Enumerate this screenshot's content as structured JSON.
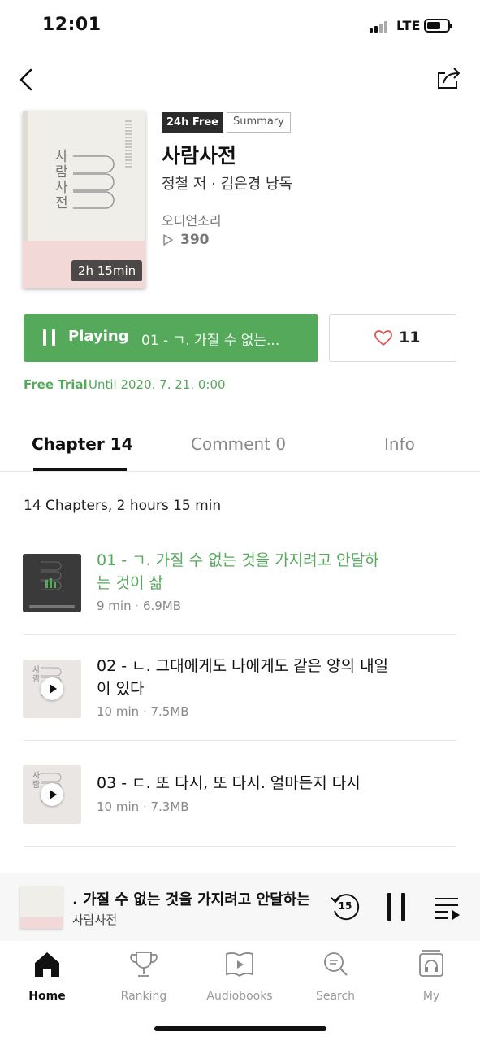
{
  "status_bar": {
    "time": "12:01",
    "network": "LTE"
  },
  "book": {
    "badge_free": "24h Free",
    "badge_summary": "Summary",
    "title": "사람사전",
    "authors": "정철 저 · 김은경 낭독",
    "publisher": "오디언소리",
    "play_count": "390",
    "duration": "2h 15min",
    "cover_title": "사람사전"
  },
  "actions": {
    "playing_label": "Playing",
    "playing_track": "01 - ㄱ. 가질 수 없는...",
    "like_count": "11"
  },
  "free_trial": {
    "label": "Free Trial",
    "until": "Until 2020. 7. 21. 0:00"
  },
  "tabs": [
    {
      "label": "Chapter 14",
      "active": true
    },
    {
      "label": "Comment 0",
      "active": false
    },
    {
      "label": "Info",
      "active": false
    }
  ],
  "chapters_summary": "14 Chapters, 2 hours 15 min",
  "chapters": [
    {
      "title": "01 - ㄱ. 가질 수 없는 것을 가지려고 안달하는 것이 삶",
      "duration": "9 min",
      "size": "6.9MB",
      "state": "playing"
    },
    {
      "title": "02 - ㄴ. 그대에게도 나에게도 같은 양의 내일이 있다",
      "duration": "10 min",
      "size": "7.5MB",
      "state": "idle"
    },
    {
      "title": "03 - ㄷ. 또 다시, 또 다시. 얼마든지 다시",
      "duration": "10 min",
      "size": "7.3MB",
      "state": "idle"
    }
  ],
  "mini_player": {
    "track": ". 가질 수 없는 것을 가지려고 안달하는",
    "book": "사람사전",
    "rewind_seconds": "15"
  },
  "bottom_nav": [
    {
      "label": "Home",
      "icon": "home-icon",
      "active": true
    },
    {
      "label": "Ranking",
      "icon": "trophy-icon",
      "active": false
    },
    {
      "label": "Audiobooks",
      "icon": "book-play-icon",
      "active": false
    },
    {
      "label": "Search",
      "icon": "search-icon",
      "active": false
    },
    {
      "label": "My",
      "icon": "headphones-icon",
      "active": false
    }
  ],
  "colors": {
    "accent": "#55a95b",
    "text": "#111111",
    "muted": "#888888"
  }
}
